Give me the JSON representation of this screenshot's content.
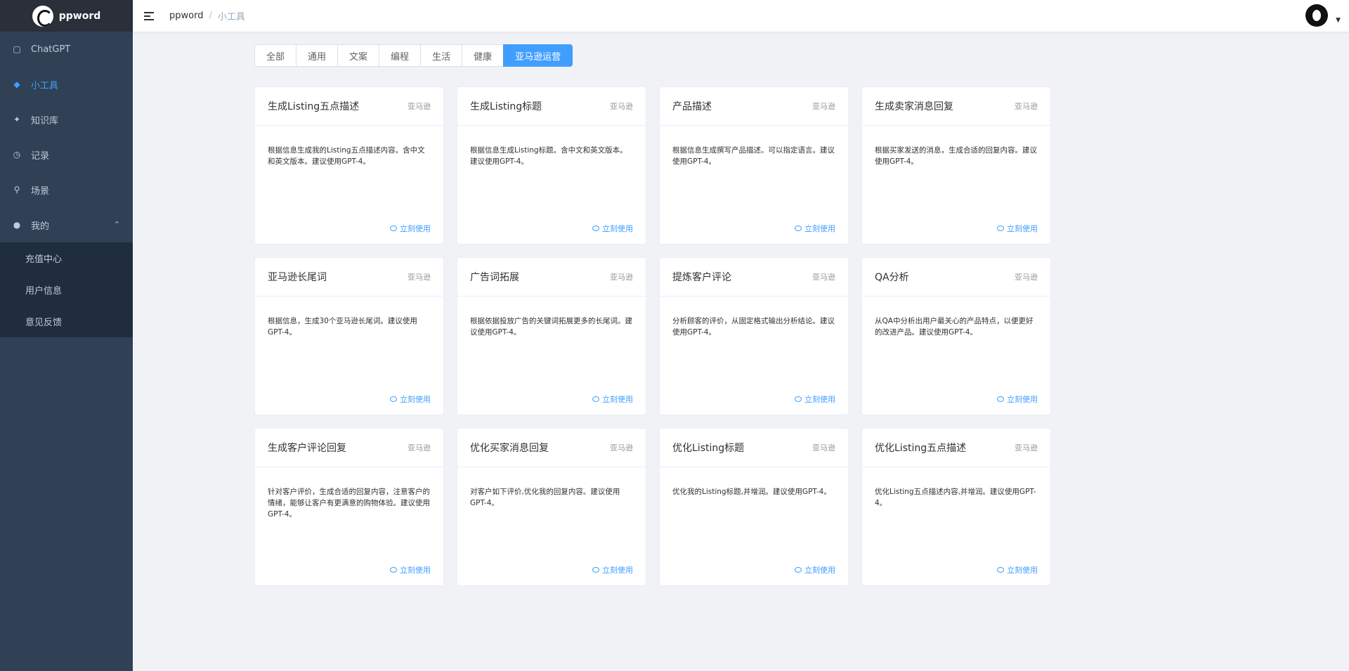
{
  "app": {
    "name": "ppword"
  },
  "sidebar": {
    "items": [
      {
        "label": "ChatGPT",
        "icon": "chat-icon"
      },
      {
        "label": "小工具",
        "icon": "layers-icon",
        "active": true
      },
      {
        "label": "知识库",
        "icon": "puzzle-icon"
      },
      {
        "label": "记录",
        "icon": "clock-icon"
      },
      {
        "label": "场景",
        "icon": "pin-icon"
      },
      {
        "label": "我的",
        "icon": "user-icon",
        "expanded": true
      }
    ],
    "submenu": [
      {
        "label": "充值中心"
      },
      {
        "label": "用户信息"
      },
      {
        "label": "意见反馈"
      }
    ]
  },
  "header": {
    "breadcrumb": {
      "home": "ppword",
      "separator": "/",
      "current": "小工具"
    }
  },
  "tabs": [
    {
      "label": "全部"
    },
    {
      "label": "通用"
    },
    {
      "label": "文案"
    },
    {
      "label": "编程"
    },
    {
      "label": "生活"
    },
    {
      "label": "健康"
    },
    {
      "label": "亚马逊运营",
      "active": true
    }
  ],
  "cards": [
    {
      "title": "生成Listing五点描述",
      "tag": "亚马逊",
      "desc": "根据信息生成我的Listing五点描述内容。含中文和英文版本。建议使用GPT-4。",
      "action": "立刻使用"
    },
    {
      "title": "生成Listing标题",
      "tag": "亚马逊",
      "desc": "根据信息生成Listing标题。含中文和英文版本。建议使用GPT-4。",
      "action": "立刻使用"
    },
    {
      "title": "产品描述",
      "tag": "亚马逊",
      "desc": "根据信息生成撰写产品描述。可以指定语言。建议使用GPT-4。",
      "action": "立刻使用"
    },
    {
      "title": "生成卖家消息回复",
      "tag": "亚马逊",
      "desc": "根据买家发送的消息，生成合适的回复内容。建议使用GPT-4。",
      "action": "立刻使用"
    },
    {
      "title": "亚马逊长尾词",
      "tag": "亚马逊",
      "desc": "根据信息，生成30个亚马逊长尾词。建议使用GPT-4。",
      "action": "立刻使用"
    },
    {
      "title": "广告词拓展",
      "tag": "亚马逊",
      "desc": "根据依据投放广告的关键词拓展更多的长尾词。建议使用GPT-4。",
      "action": "立刻使用"
    },
    {
      "title": "提炼客户评论",
      "tag": "亚马逊",
      "desc": "分析顾客的评价，从固定格式输出分析结论。建议使用GPT-4。",
      "action": "立刻使用"
    },
    {
      "title": "QA分析",
      "tag": "亚马逊",
      "desc": "从QA中分析出用户最关心的产品特点，以便更好的改进产品。建议使用GPT-4。",
      "action": "立刻使用"
    },
    {
      "title": "生成客户评论回复",
      "tag": "亚马逊",
      "desc": "针对客户评价，生成合适的回复内容，注意客户的情绪，能够让客户有更满意的购物体验。建议使用GPT-4。",
      "action": "立刻使用"
    },
    {
      "title": "优化买家消息回复",
      "tag": "亚马逊",
      "desc": "对客户如下评价,优化我的回复内容。建议使用GPT-4。",
      "action": "立刻使用"
    },
    {
      "title": "优化Listing标题",
      "tag": "亚马逊",
      "desc": "优化我的Listing标题,并增润。建议使用GPT-4。",
      "action": "立刻使用"
    },
    {
      "title": "优化Listing五点描述",
      "tag": "亚马逊",
      "desc": "优化Listing五点描述内容,并增润。建议使用GPT-4。",
      "action": "立刻使用"
    }
  ],
  "colors": {
    "sidebar_bg": "#304156",
    "accent": "#409eff",
    "submenu_bg": "#1f2d3d"
  }
}
